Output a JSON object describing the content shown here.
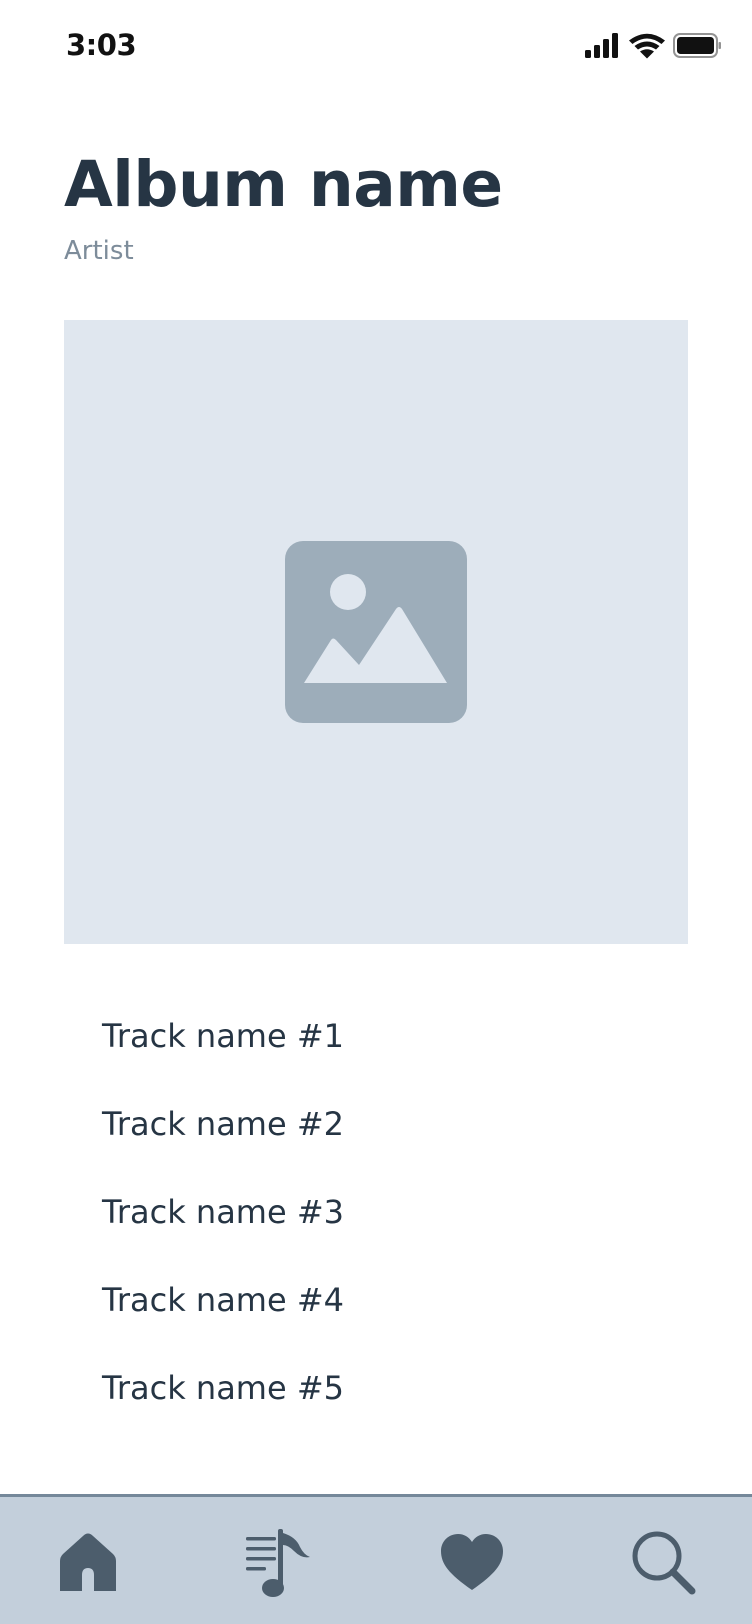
{
  "status_bar": {
    "time": "3:03",
    "icons": [
      "signal-icon",
      "wifi-icon",
      "battery-icon"
    ]
  },
  "album": {
    "title": "Album name",
    "artist": "Artist",
    "cover_icon": "image-placeholder-icon"
  },
  "tracks": [
    "Track name #1",
    "Track name #2",
    "Track name #3",
    "Track name #4",
    "Track name #5"
  ],
  "tab_bar": {
    "tabs": [
      {
        "icon": "home-icon"
      },
      {
        "icon": "playlist-icon"
      },
      {
        "icon": "heart-icon"
      },
      {
        "icon": "search-icon"
      }
    ]
  },
  "colors": {
    "text_primary": "#263544",
    "text_secondary": "#7d8c9a",
    "cover_background": "#e0e7ef",
    "cover_icon": "#9dadba",
    "tab_bar_background": "#c3cfdb",
    "tab_icon": "#4c5d6c"
  }
}
